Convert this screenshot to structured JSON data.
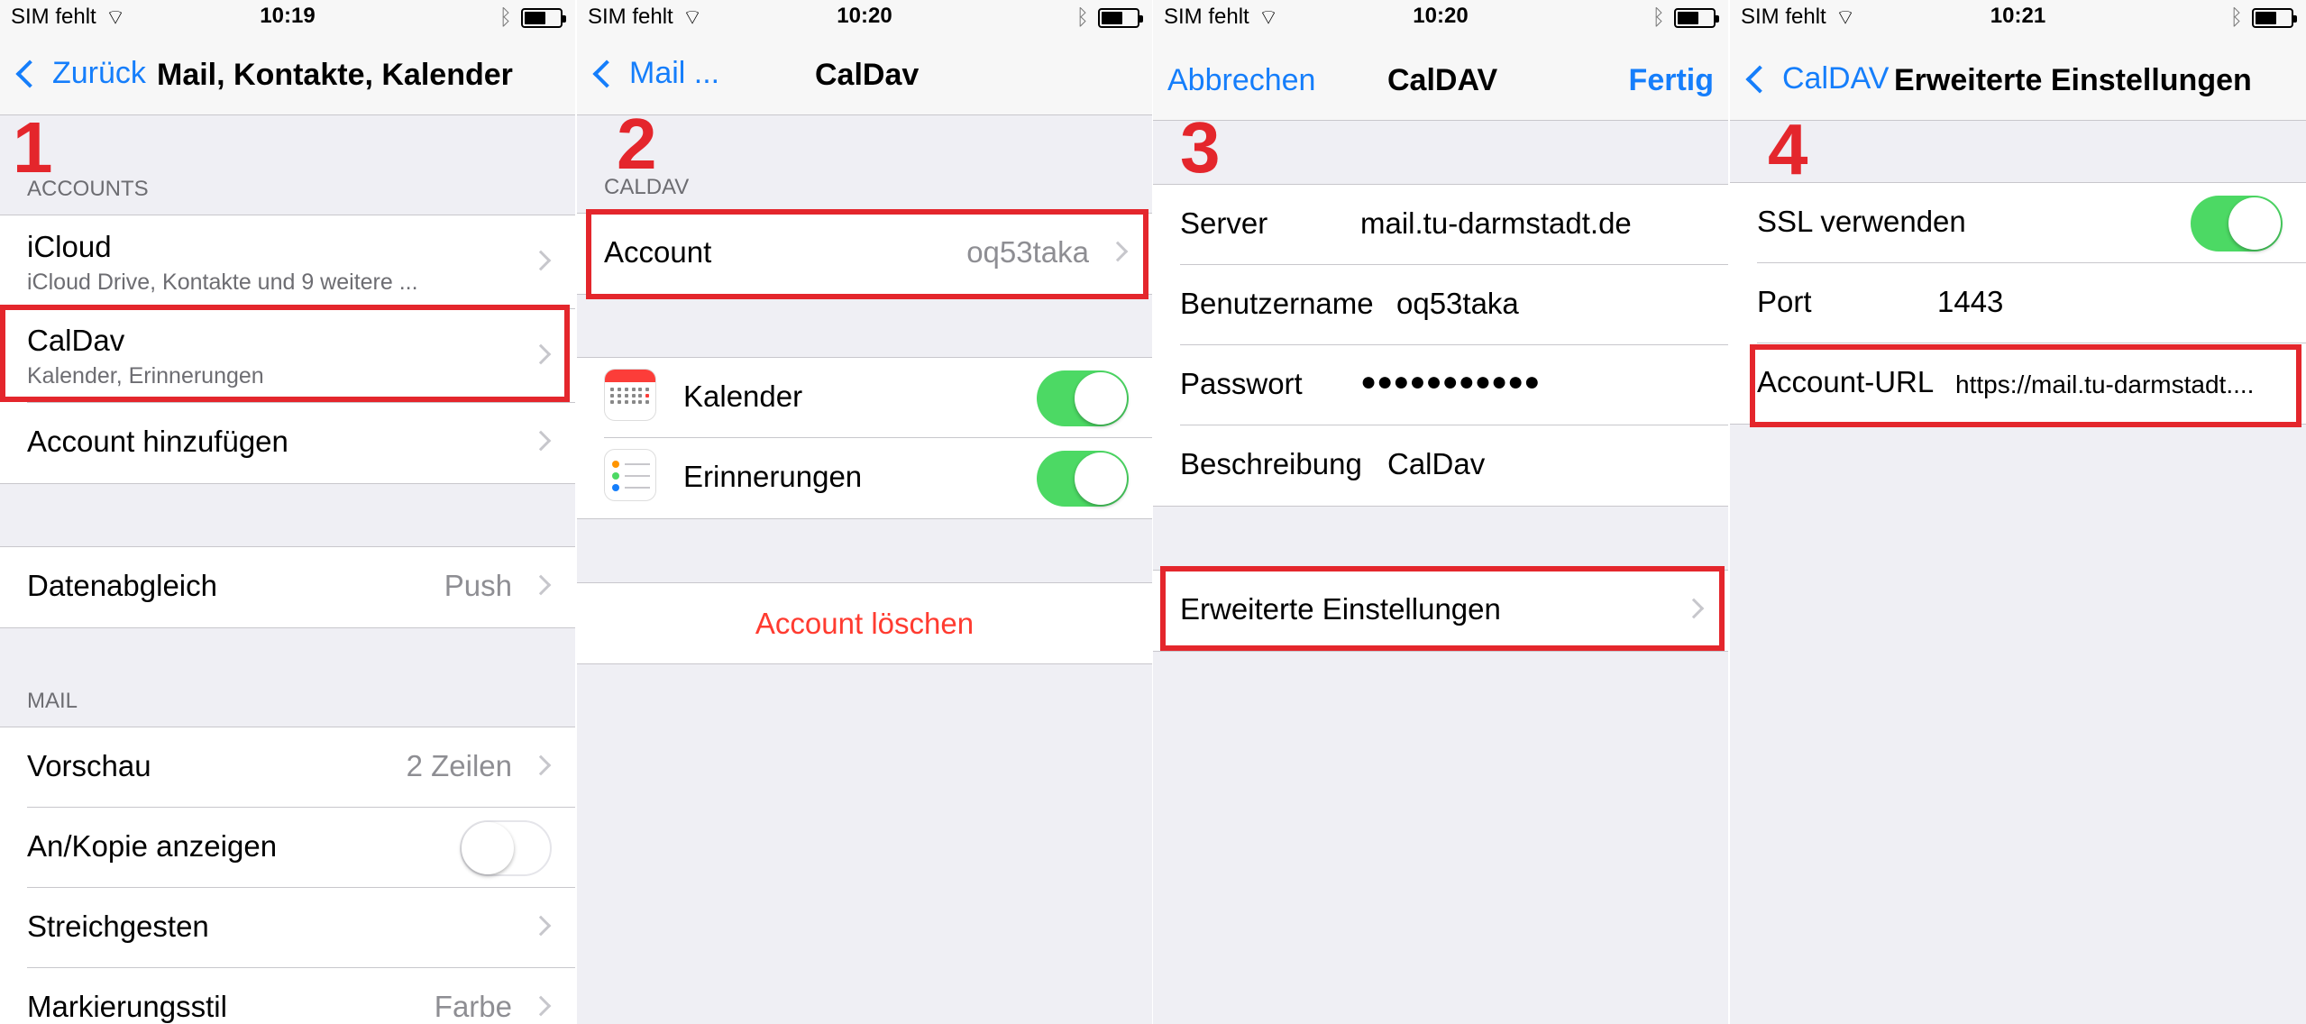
{
  "status_bar": {
    "carrier": "SIM fehlt"
  },
  "steps": [
    "1",
    "2",
    "3",
    "4"
  ],
  "panel1": {
    "time": "10:19",
    "back_label": "Zurück",
    "title": "Mail, Kontakte, Kalender",
    "accounts_header": "ACCOUNTS",
    "accounts": [
      {
        "label": "iCloud",
        "sub": "iCloud Drive, Kontakte und 9 weitere ..."
      },
      {
        "label": "CalDav",
        "sub": "Kalender, Erinnerungen"
      },
      {
        "label": "Account hinzufügen"
      }
    ],
    "fetch": {
      "label": "Datenabgleich",
      "value": "Push"
    },
    "mail_header": "MAIL",
    "mail_items": [
      {
        "label": "Vorschau",
        "value": "2 Zeilen"
      },
      {
        "label": "An/Kopie anzeigen"
      },
      {
        "label": "Streichgesten"
      },
      {
        "label": "Markierungsstil",
        "value": "Farbe"
      }
    ]
  },
  "panel2": {
    "time": "10:20",
    "back_label": "Mail ...",
    "title": "CalDav",
    "section_header": "CALDAV",
    "account": {
      "label": "Account",
      "value": "oq53taka"
    },
    "services": [
      {
        "label": "Kalender",
        "on": true
      },
      {
        "label": "Erinnerungen",
        "on": true
      }
    ],
    "delete_label": "Account löschen"
  },
  "panel3": {
    "time": "10:20",
    "cancel_label": "Abbrechen",
    "title": "CalDAV",
    "done_label": "Fertig",
    "fields": [
      {
        "label": "Server",
        "value": "mail.tu-darmstadt.de"
      },
      {
        "label": "Benutzername",
        "value": "oq53taka"
      },
      {
        "label": "Passwort",
        "value": "●●●●●●●●●●●"
      },
      {
        "label": "Beschreibung",
        "value": "CalDav"
      }
    ],
    "advanced_label": "Erweiterte Einstellungen"
  },
  "panel4": {
    "time": "10:21",
    "back_label": "CalDAV",
    "title": "Erweiterte Einstellungen",
    "ssl": {
      "label": "SSL verwenden",
      "on": true
    },
    "port": {
      "label": "Port",
      "value": "1443"
    },
    "account_url": {
      "label": "Account-URL",
      "value": "https://mail.tu-darmstadt...."
    }
  },
  "colors": {
    "ios_blue": "#157efb",
    "highlight_red": "#e4262c",
    "switch_green": "#4cd964",
    "destructive": "#ff3b30"
  }
}
